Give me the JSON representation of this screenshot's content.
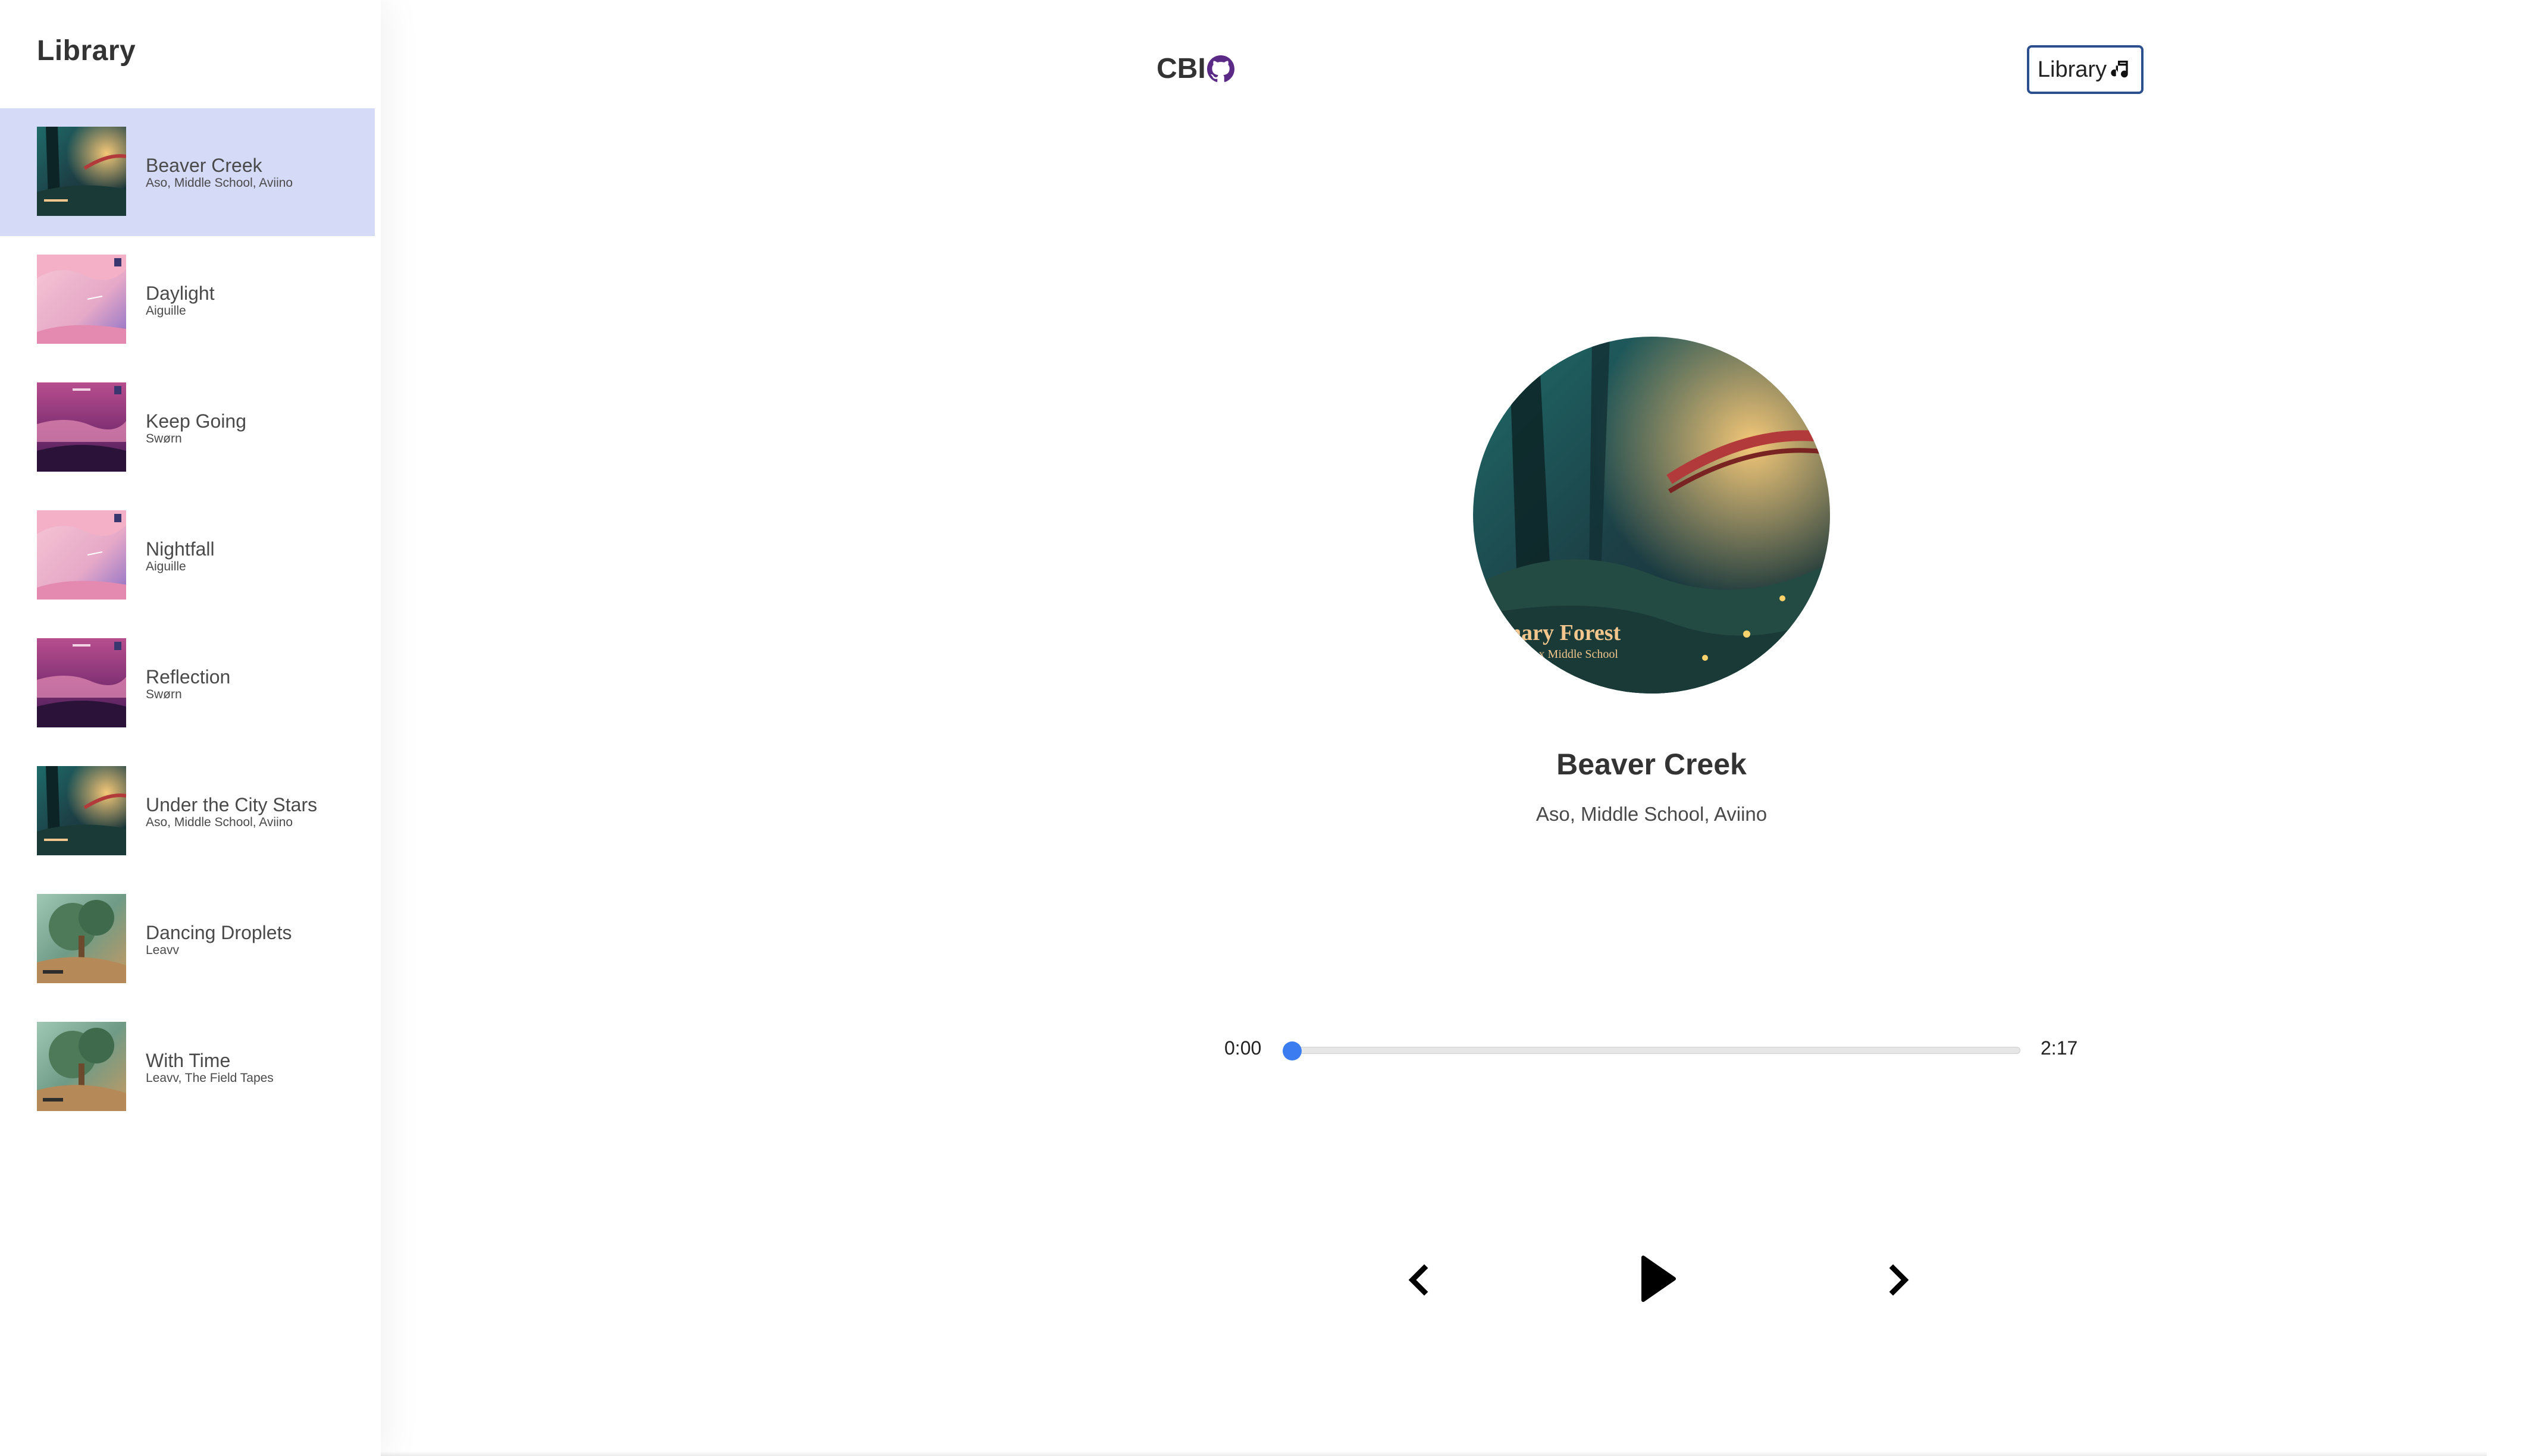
{
  "sidebar": {
    "title": "Library",
    "songs": [
      {
        "title": "Beaver Creek",
        "artist": "Aso, Middle School, Aviino",
        "art": "forest"
      },
      {
        "title": "Daylight",
        "artist": "Aiguille",
        "art": "pink"
      },
      {
        "title": "Keep Going",
        "artist": "Swørn",
        "art": "magenta"
      },
      {
        "title": "Nightfall",
        "artist": "Aiguille",
        "art": "pink"
      },
      {
        "title": "Reflection",
        "artist": "Swørn",
        "art": "magenta"
      },
      {
        "title": "Under the City Stars",
        "artist": "Aso, Middle School, Aviino",
        "art": "forest"
      },
      {
        "title": "Dancing Droplets",
        "artist": "Leavv",
        "art": "tree"
      },
      {
        "title": "With Time",
        "artist": "Leavv, The Field Tapes",
        "art": "tree"
      }
    ],
    "active_index": 0
  },
  "header": {
    "logo_text": "CBI",
    "logo_icon": "github-icon",
    "library_button_label": "Library",
    "library_button_icon": "music-note-icon"
  },
  "player": {
    "title": "Beaver Creek",
    "artist": "Aso, Middle School, Aviino",
    "cover_caption": "nary Forest",
    "cover_subcaption": "ino x Middle School",
    "current_time": "0:00",
    "duration": "2:17",
    "progress": 0.0,
    "controls": {
      "prev_icon": "chevron-left-icon",
      "play_icon": "play-icon",
      "next_icon": "chevron-right-icon"
    }
  },
  "colors": {
    "active_row": "#d5daf7",
    "slider_thumb": "#3b7df0",
    "button_border": "#2b4f8f",
    "logo_icon": "#5b2a86"
  }
}
